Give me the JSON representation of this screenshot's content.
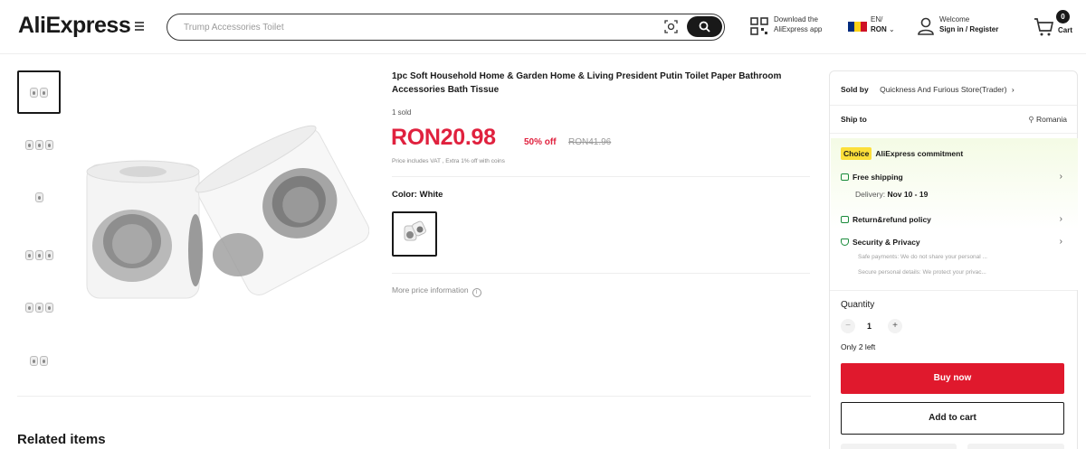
{
  "header": {
    "logo": "AliExpress",
    "search_placeholder": "Trump Accessories Toilet",
    "app_line1": "Download the",
    "app_line2": "AliExpress app",
    "lang_line1": "EN/",
    "lang_line2": "RON",
    "welcome_line1": "Welcome",
    "welcome_line2": "Sign in / Register",
    "cart_count": "0",
    "cart_label": "Cart"
  },
  "product": {
    "title": "1pc Soft Household Home & Garden Home & Living President Putin Toilet Paper Bathroom Accessories Bath Tissue",
    "sold": "1 sold",
    "price": "RON20.98",
    "discount": "50% off",
    "original_price": "RON41.96",
    "vat_note": "Price includes VAT , Extra 1% off with coins",
    "color_label": "Color:",
    "color_value": "White",
    "more_price": "More price information"
  },
  "panel": {
    "sold_by_label": "Sold by",
    "sold_by_store": "Quickness And Furious Store(Trader)",
    "ship_to_label": "Ship to",
    "ship_to_country": "Romania",
    "choice_badge": "Choice",
    "commitment": "AliExpress commitment",
    "free_shipping": "Free shipping",
    "delivery_label": "Delivery:",
    "delivery_dates": "Nov 10 - 19",
    "return_policy": "Return&refund policy",
    "security": "Security & Privacy",
    "security_sub1": "Safe payments: We do not share your personal ...",
    "security_sub2": "Secure personal details: We protect your privac...",
    "quantity_label": "Quantity",
    "quantity_value": "1",
    "stock_note": "Only 2 left",
    "buy_now": "Buy now",
    "add_to_cart": "Add to cart"
  },
  "related": {
    "title": "Related items"
  },
  "colors": {
    "accent_red": "#e0213e",
    "buy_button": "#e0192d",
    "choice_yellow": "#fcdf3a",
    "commit_green": "#1a8b3b"
  }
}
